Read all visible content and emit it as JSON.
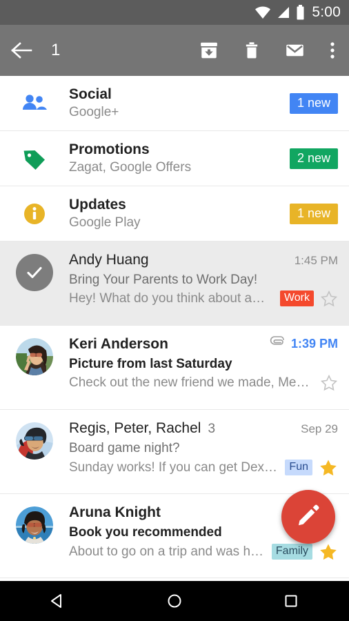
{
  "status_bar": {
    "time": "5:00",
    "icons": [
      "wifi-icon",
      "cellular-signal-icon",
      "battery-icon"
    ]
  },
  "action_bar": {
    "back_label": "back-arrow",
    "selection_count": "1",
    "actions": [
      {
        "name": "archive-button",
        "label": "Archive"
      },
      {
        "name": "delete-button",
        "label": "Delete"
      },
      {
        "name": "mark-unread-button",
        "label": "Mark as unread"
      },
      {
        "name": "overflow-menu-button",
        "label": "More options"
      }
    ],
    "bg_color": "#757575"
  },
  "categories": [
    {
      "icon": "people-icon",
      "icon_color": "#4285F4",
      "title": "Social",
      "subtitle": "Google+",
      "badge": "1 new",
      "badge_color": "#4285F4"
    },
    {
      "icon": "tag-icon",
      "icon_color": "#0F9D58",
      "title": "Promotions",
      "subtitle": "Zagat, Google Offers",
      "badge": "2 new",
      "badge_color": "#11A661"
    },
    {
      "icon": "info-icon",
      "icon_color": "#E8B427",
      "title": "Updates",
      "subtitle": "Google Play",
      "badge": "1 new",
      "badge_color": "#E8B427"
    }
  ],
  "emails": [
    {
      "avatar": "selected-check-avatar",
      "selected": true,
      "sender": "Andy Huang",
      "thread_count": "",
      "subject": "Bring Your Parents to Work Day!",
      "snippet": "Hey! What do you think about a…",
      "time": "1:45 PM",
      "unread": false,
      "attachment": false,
      "label": "Work",
      "label_bg": "#F4492D",
      "label_color": "#FFFFFF",
      "starred": false
    },
    {
      "avatar": "photo-avatar-keri",
      "selected": false,
      "sender": "Keri Anderson",
      "thread_count": "",
      "subject": "Picture from last Saturday",
      "snippet": "Check out the new friend we made, Me…",
      "time": "1:39 PM",
      "unread": true,
      "attachment": true,
      "label": "",
      "label_bg": "",
      "label_color": "",
      "starred": false
    },
    {
      "avatar": "photo-avatar-regis",
      "selected": false,
      "sender": "Regis, Peter, Rachel",
      "thread_count": "3",
      "subject": "Board game night?",
      "snippet": "Sunday works! If you can get Dex…",
      "time": "Sep 29",
      "unread": false,
      "attachment": false,
      "label": "Fun",
      "label_bg": "#C6DAFC",
      "label_color": "#2A4D8F",
      "starred": true
    },
    {
      "avatar": "photo-avatar-aruna",
      "selected": false,
      "sender": "Aruna Knight",
      "thread_count": "",
      "subject": "Book you recommended",
      "snippet": "About to go on a trip and was h…",
      "time": "",
      "unread": true,
      "attachment": false,
      "label": "Family",
      "label_bg": "#A6DCE2",
      "label_color": "#2A4D5F",
      "starred": true
    }
  ],
  "fab": {
    "icon": "compose-pencil-icon",
    "color": "#DB4437",
    "label": "Compose"
  },
  "nav_bar": {
    "buttons": [
      {
        "name": "nav-back-button",
        "label": "Back"
      },
      {
        "name": "nav-home-button",
        "label": "Home"
      },
      {
        "name": "nav-recents-button",
        "label": "Recents"
      }
    ]
  }
}
